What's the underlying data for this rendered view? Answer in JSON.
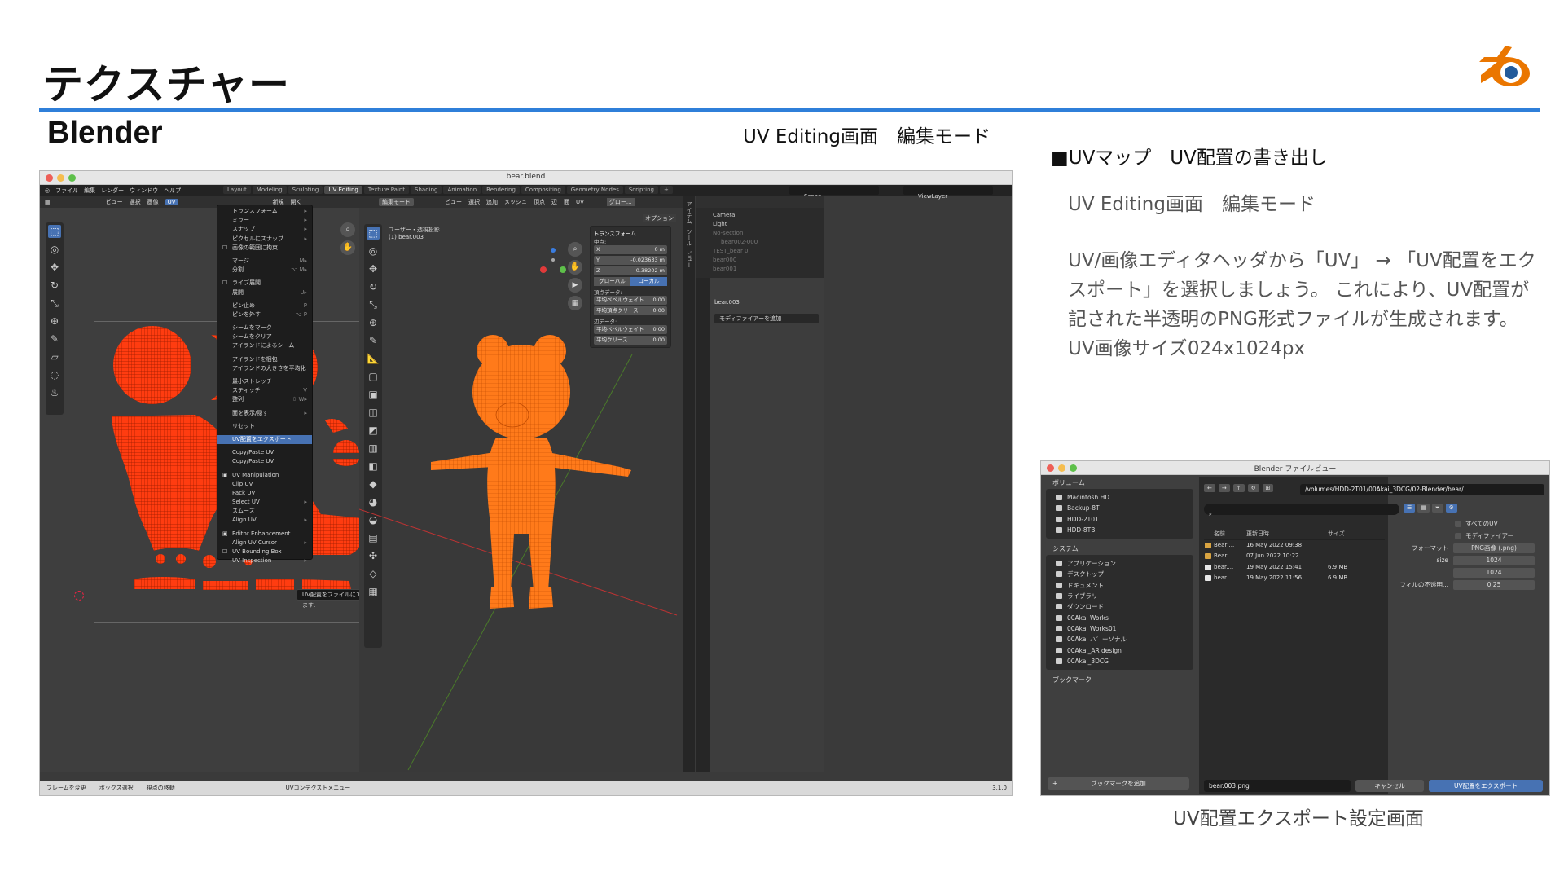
{
  "slide": {
    "title": "テクスチャー",
    "app_name": "Blender",
    "caption_top": "UV Editing画面　編集モード",
    "section_heading": "■UVマップ　UV配置の書き出し",
    "section_subheading": "UV Editing画面　編集モード",
    "section_body": "UV/画像エディタヘッダから「UV」 → 「UV配置をエクスポート」を選択しましょう。 これにより、UV配置が記された半透明のPNG形式ファイルが生成されます。UV画像サイズ024x1024px",
    "caption_bottom": "UV配置エクスポート設定画面"
  },
  "colors": {
    "accent_rule": "#2f7fd9",
    "mesh_orange": "#ff7a1a",
    "uv_red": "#ff3c10",
    "blender_blue": "#4772b3"
  },
  "blender": {
    "window_title": "bear.blend",
    "topbar_menus": [
      "ファイル",
      "編集",
      "レンダー",
      "ウィンドウ",
      "ヘルプ"
    ],
    "workspace_tabs": [
      "Layout",
      "Modeling",
      "Sculpting",
      "UV Editing",
      "Texture Paint",
      "Shading",
      "Animation",
      "Rendering",
      "Compositing",
      "Geometry Nodes",
      "Scripting"
    ],
    "active_workspace": "UV Editing",
    "scene": "Scene",
    "view_layer": "ViewLayer",
    "uv_header": [
      "ビュー",
      "選択",
      "画像",
      "UV"
    ],
    "uv_new": "新規",
    "uv_open": "開く",
    "uv_menu": [
      {
        "label": "トランスフォーム",
        "sub": true
      },
      {
        "label": "ミラー",
        "sub": true
      },
      {
        "label": "スナップ",
        "sub": true
      },
      {
        "label": "ピクセルにスナップ",
        "sub": true
      },
      {
        "label": "画像の範囲に拘束",
        "check": true,
        "sep": true
      },
      {
        "label": "マージ",
        "shortcut": "M▸"
      },
      {
        "label": "分割",
        "shortcut": "⌥ M▸",
        "sep": true
      },
      {
        "label": "ライブ展開",
        "check": true
      },
      {
        "label": "展開",
        "shortcut": "U▸",
        "sep": true
      },
      {
        "label": "ピン止め",
        "shortcut": "P"
      },
      {
        "label": "ピンを外す",
        "shortcut": "⌥ P",
        "sep": true
      },
      {
        "label": "シームをマーク"
      },
      {
        "label": "シームをクリア"
      },
      {
        "label": "アイランドによるシーム",
        "sep": true
      },
      {
        "label": "アイランドを梱包"
      },
      {
        "label": "アイランドの大きさを平均化",
        "sep": true
      },
      {
        "label": "最小ストレッチ"
      },
      {
        "label": "スティッチ",
        "shortcut": "V"
      },
      {
        "label": "整列",
        "shortcut": "⇧ W▸",
        "sep": true
      },
      {
        "label": "面を表示/隠す",
        "sub": true,
        "sep": true
      },
      {
        "label": "リセット",
        "sep": true
      },
      {
        "label": "UV配置をエクスポート",
        "highlight": true,
        "sep": true
      },
      {
        "label": "Copy/Paste UV"
      },
      {
        "label": "Copy/Paste UV",
        "sep": true
      },
      {
        "label": "UV Manipulation"
      },
      {
        "label": "Clip UV"
      },
      {
        "label": "Pack UV"
      },
      {
        "label": "Select UV",
        "sub": true
      },
      {
        "label": "スムーズ"
      },
      {
        "label": "Align UV",
        "sub": true,
        "sep": true
      },
      {
        "label": "Editor Enhancement"
      },
      {
        "label": "Align UV Cursor",
        "sub": true
      },
      {
        "label": "UV Bounding Box",
        "check": true
      },
      {
        "label": "UV Inspection",
        "sub": true
      }
    ],
    "tooltip": "UV配置をファイルにエクスポートします.",
    "viewport_header": [
      "編集モード",
      "ビュー",
      "選択",
      "追加",
      "メッシュ",
      "頂点",
      "辺",
      "面",
      "UV"
    ],
    "viewport_overlay": "グロー...",
    "viewport_options": "オプション",
    "viewport_info": [
      "ユーザー・透視投影",
      "(1) bear.003"
    ],
    "transform_panel": {
      "title": "トランスフォーム",
      "median_label": "中点:",
      "x_value": "0 m",
      "y_value": "-0.023633 m",
      "z_value": "0.38202 m",
      "global_btn": "グローバル",
      "local_btn": "ローカル",
      "vertex_data_label": "頂点データ:",
      "vertex_bevel_label": "平均ベベルウェイト",
      "vertex_bevel_value": "0.00",
      "vertex_crease_label": "平均頂点クリース",
      "vertex_crease_value": "0.00",
      "edge_data_label": "辺データ:",
      "edge_bevel_label": "平均ベベルウェイト",
      "edge_bevel_value": "0.00",
      "edge_crease_label": "平均クリース",
      "edge_crease_value": "0.00"
    },
    "side_tabs": [
      "アイテム",
      "ツール",
      "ビュー"
    ],
    "outliner_rows": [
      "Camera",
      "Light",
      "No-section",
      "bear002-000",
      "TEST_bear 0",
      "bear000",
      "bear001"
    ],
    "props_object": "bear.003",
    "props_modifier": "モディファイアーを追加",
    "statusbar": [
      "フレームを変更",
      "ボックス選択",
      "視点の移動",
      "UVコンテクストメニュー"
    ],
    "version": "3.1.0"
  },
  "file_browser": {
    "title": "Blender ファイルビュー",
    "volumes_head": "ボリューム",
    "volumes": [
      "Macintosh HD",
      "Backup-8T",
      "HDD-2T01",
      "HDD-8TB"
    ],
    "system_head": "システム",
    "system": [
      "アプリケーション",
      "デスクトップ",
      "ドキュメント",
      "ライブラリ",
      "ダウンロード",
      "00Akai Works",
      "00Akai Works01",
      "00Akai ハ゜ーソナル",
      "00Akai_AR design",
      "00Akai_3DCG"
    ],
    "bookmarks_head": "ブックマーク",
    "add_bookmark": "ブックマークを追加",
    "path": "/volumes/HDD-2T01/00Akai_3DCG/02-Blender/bear/",
    "columns": [
      "名前",
      "更新日時",
      "サイズ"
    ],
    "files": [
      {
        "name": "Bear ...",
        "date": "16 May 2022 09:38",
        "size": "",
        "kind": "folder"
      },
      {
        "name": "Bear ...",
        "date": "07 Jun 2022 10:22",
        "size": "",
        "kind": "folder"
      },
      {
        "name": "bear....",
        "date": "19 May 2022 15:41",
        "size": "6.9 MB",
        "kind": "blend"
      },
      {
        "name": "bear....",
        "date": "19 May 2022 11:56",
        "size": "6.9 MB",
        "kind": "blend"
      }
    ],
    "opt_all_uv": "すべてのUV",
    "opt_modifier": "モディファイアー",
    "format_label": "フォーマット",
    "format_value": "PNG画像 (.png)",
    "size_label": "size",
    "size_x": "1024",
    "size_y": "1024",
    "opacity_label": "フィルの不透明...",
    "opacity_value": "0.25",
    "filename": "bear.003.png",
    "cancel": "キャンセル",
    "export": "UV配置をエクスポート"
  }
}
